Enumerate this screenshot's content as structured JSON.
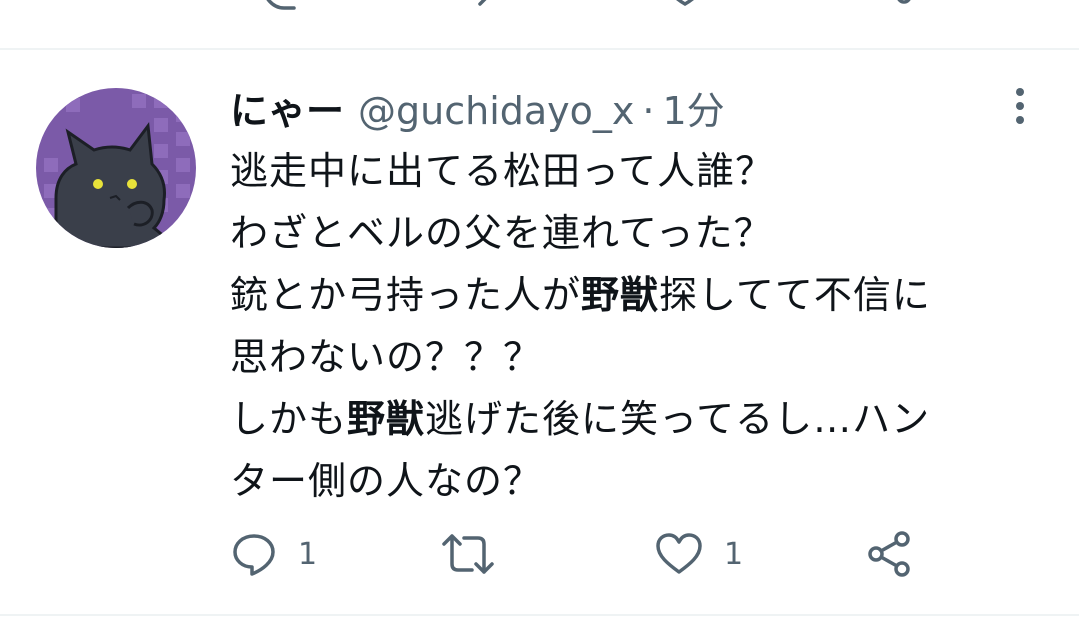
{
  "tweet": {
    "display_name": "にゃー",
    "handle": "@guchidayo_x",
    "separator": "·",
    "time": "1分",
    "text_lines": [
      [
        "逃走中に出てる松田って人誰？"
      ],
      [
        "わざとベルの父を連れてった？"
      ],
      [
        "銃とか弓持った人が",
        "野獣",
        "探してて不信に"
      ],
      [
        "思わないの？？？"
      ],
      [
        "しかも",
        "野獣",
        "逃げた後に笑ってるし…ハン"
      ],
      [
        "ター側の人なの？"
      ]
    ]
  },
  "actions": {
    "reply_count": "1",
    "like_count": "1"
  },
  "icons": {
    "reply": "reply-icon",
    "retweet": "retweet-icon",
    "like": "heart-icon",
    "share": "share-icon",
    "more": "more-vertical-icon",
    "avatar": "black-cat-avatar"
  },
  "colors": {
    "text": "#0f1419",
    "secondary": "#536471",
    "divider": "#eff3f4",
    "avatar_bg": "#7b5aa8"
  }
}
